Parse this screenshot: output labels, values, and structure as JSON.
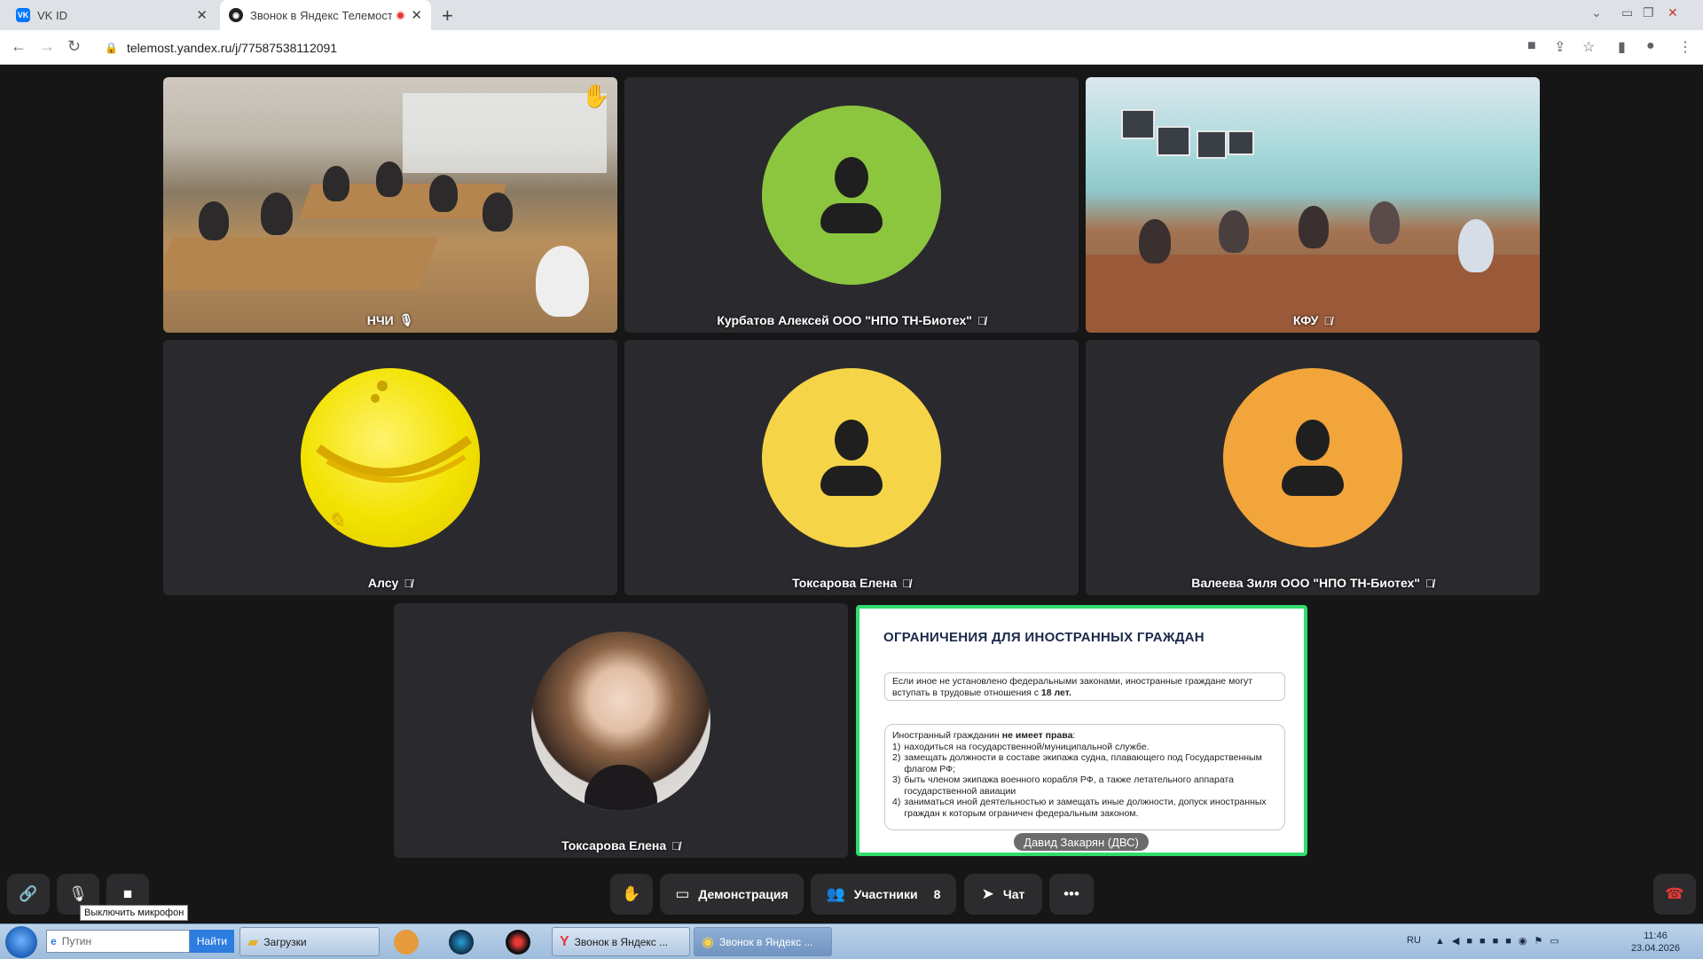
{
  "browser": {
    "tabs": [
      {
        "title": "VK ID",
        "favicon": "vk-icon",
        "active": false
      },
      {
        "title": "Звонок в Яндекс Телемосте",
        "favicon": "telemost-icon",
        "active": true
      }
    ],
    "url": "telemost.yandex.ru/j/77587538112091"
  },
  "meeting": {
    "tiles": [
      {
        "name": "НЧИ",
        "mic": "on",
        "kind": "video-classroom",
        "raised_hand": true
      },
      {
        "name": "Курбатов Алексей ООО \"НПО ТН-Биотех\"",
        "mic": "off",
        "kind": "avatar",
        "avatar_color": "#8cc63f"
      },
      {
        "name": "КФУ",
        "mic": "off",
        "kind": "video-classroom"
      },
      {
        "name": "Алсу",
        "mic": "off",
        "kind": "avatar-image",
        "avatar_color": "#f2e200"
      },
      {
        "name": "Токсарова Елена",
        "mic": "off",
        "kind": "avatar",
        "avatar_color": "#f5d547"
      },
      {
        "name": "Валеева Зиля ООО \"НПО ТН-Биотех\"",
        "mic": "off",
        "kind": "avatar",
        "avatar_color": "#f2a53a"
      },
      {
        "name": "Токсарова Елена",
        "mic": "off",
        "kind": "photo-avatar"
      }
    ],
    "screen_share": {
      "title": "ОГРАНИЧЕНИЯ ДЛЯ ИНОСТРАННЫХ ГРАЖДАН",
      "box1_text": "Если иное не установлено федеральными законами, иностранные граждане могут вступать в трудовые отношения с",
      "box1_bold": "18 лет.",
      "box2_intro": "Иностранный гражданин",
      "box2_intro_bold": "не имеет права",
      "box2_items": [
        {
          "num": "1)",
          "text": "находиться на государственной/муниципальной службе."
        },
        {
          "num": "2)",
          "text": "замещать должности в составе экипажа судна, плавающего под Государственным флагом РФ;"
        },
        {
          "num": "3)",
          "text": "быть членом экипажа военного корабля РФ, а также летательного аппарата государственной авиации"
        },
        {
          "num": "4)",
          "text": "заниматься иной деятельностью и замещать иные должности, допуск иностранных граждан к которым ограничен федеральным законом."
        }
      ],
      "presenter": "Давид Закарян (ДВС)"
    },
    "toolbar": {
      "demo_label": "Демонстрация",
      "participants_label": "Участники",
      "participants_count": "8",
      "chat_label": "Чат",
      "mic_tooltip": "Выключить микрофон"
    }
  },
  "taskbar": {
    "search_value": "Путин",
    "search_button": "Найти",
    "items": [
      {
        "label": "Загрузки",
        "icon": "folder-icon"
      },
      {
        "label": "Звонок в Яндекс ...",
        "icon": "yandex-browser-icon"
      },
      {
        "label": "Звонок в Яндекс ...",
        "icon": "chrome-icon"
      }
    ],
    "lang": "RU",
    "time": "11:46",
    "date": "23.04.2026"
  }
}
